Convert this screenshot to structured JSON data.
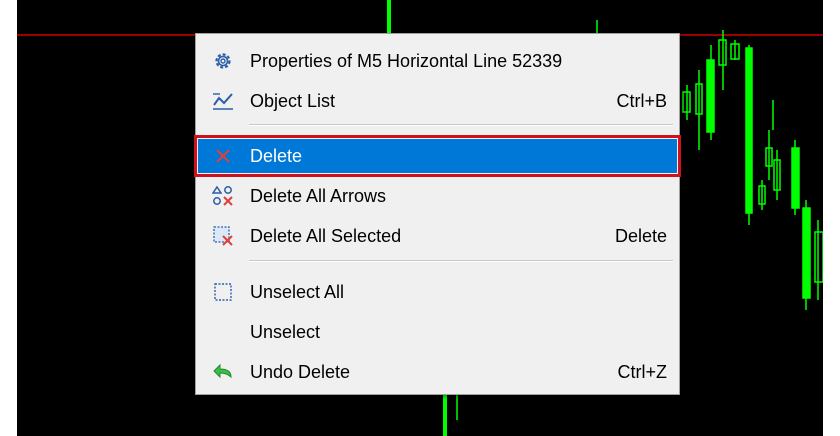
{
  "context_menu": {
    "items": [
      {
        "label": "Properties of M5 Horizontal Line 52339",
        "shortcut": "",
        "icon": "gear-icon"
      },
      {
        "label": "Object List",
        "shortcut": "Ctrl+B",
        "icon": "object-list-icon"
      },
      {
        "label": "Delete",
        "shortcut": "",
        "icon": "delete-x-icon",
        "highlighted": true
      },
      {
        "label": "Delete All Arrows",
        "shortcut": "",
        "icon": "delete-arrows-icon"
      },
      {
        "label": "Delete All Selected",
        "shortcut": "Delete",
        "icon": "delete-selected-icon"
      },
      {
        "label": "Unselect All",
        "shortcut": "",
        "icon": "unselect-all-icon"
      },
      {
        "label": "Unselect",
        "shortcut": "",
        "icon": ""
      },
      {
        "label": "Undo Delete",
        "shortcut": "Ctrl+Z",
        "icon": "undo-arrow-icon"
      }
    ]
  },
  "colors": {
    "chart_background": "#000000",
    "horizontal_line": "#d00000",
    "candles": "#00ff00",
    "highlight": "#0078d7",
    "highlight_border": "#d0101b"
  }
}
